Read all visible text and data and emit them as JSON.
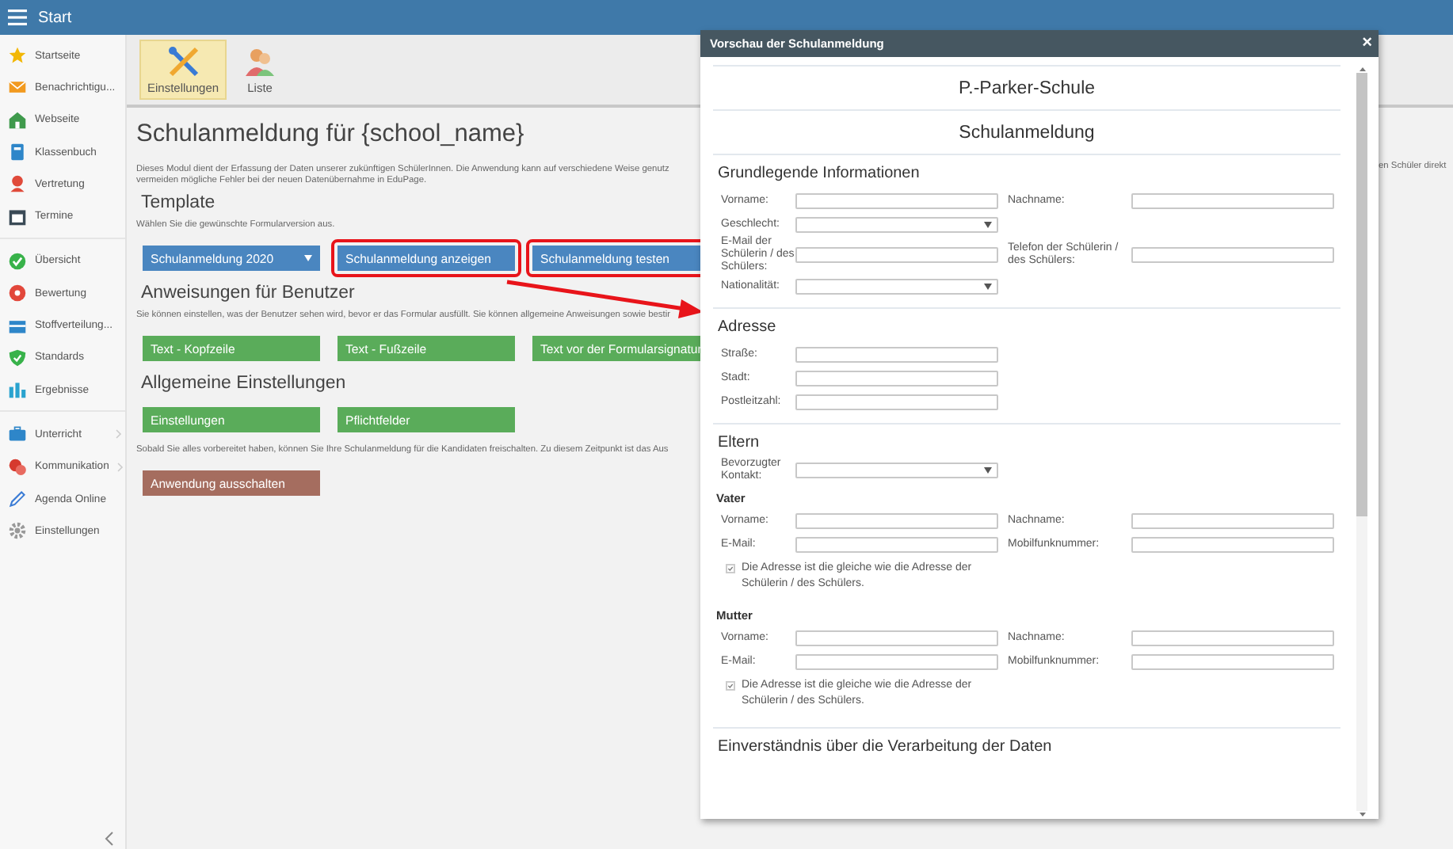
{
  "topbar": {
    "title": "Start"
  },
  "sidebar": {
    "groups": [
      {
        "items": [
          {
            "label": "Startseite",
            "submenu": false
          },
          {
            "label": "Benachrichtigu...",
            "submenu": false
          },
          {
            "label": "Webseite",
            "submenu": false
          },
          {
            "label": "Klassenbuch",
            "submenu": false
          },
          {
            "label": "Vertretung",
            "submenu": false
          },
          {
            "label": "Termine",
            "submenu": false
          }
        ]
      },
      {
        "items": [
          {
            "label": "Übersicht",
            "submenu": false
          },
          {
            "label": "Bewertung",
            "submenu": false
          },
          {
            "label": "Stoffverteilung...",
            "submenu": false
          },
          {
            "label": "Standards",
            "submenu": false
          },
          {
            "label": "Ergebnisse",
            "submenu": false
          }
        ]
      },
      {
        "items": [
          {
            "label": "Unterricht",
            "submenu": true
          },
          {
            "label": "Kommunikation",
            "submenu": true
          },
          {
            "label": "Agenda Online",
            "submenu": false
          },
          {
            "label": "Einstellungen",
            "submenu": false
          }
        ]
      }
    ]
  },
  "toolbar": [
    {
      "label": "Einstellungen",
      "selected": true
    },
    {
      "label": "Liste",
      "selected": false
    }
  ],
  "page": {
    "title": "Schulanmeldung für {school_name}",
    "intro": [
      "Dieses Modul dient der Erfassung der Daten unserer zukünftigen SchülerInnen. Die Anwendung kann auf verschiedene Weise genutz",
      "vermeiden mögliche Fehler bei der neuen Datenübernahme in EduPage."
    ],
    "intro_right": "en Schüler direkt",
    "sections": [
      {
        "heading": "Template",
        "note": "Wählen Sie die gewünschte Formularversion aus.",
        "buttons": [
          {
            "label": "Schulanmeldung 2020",
            "kind": "select",
            "highlighted": false
          },
          {
            "label": "Schulanmeldung anzeigen",
            "kind": "primary",
            "highlighted": true
          },
          {
            "label": "Schulanmeldung testen",
            "kind": "primary",
            "highlighted": true
          }
        ]
      },
      {
        "heading": "Anweisungen für Benutzer",
        "note": "Sie können einstellen, was der Benutzer sehen wird, bevor er das Formular ausfüllt. Sie können allgemeine Anweisungen sowie bestir",
        "buttons": [
          {
            "label": "Text - Kopfzeile",
            "kind": "success",
            "highlighted": false
          },
          {
            "label": "Text - Fußzeile",
            "kind": "success",
            "highlighted": false
          },
          {
            "label": "Text vor der Formularsignatur",
            "kind": "success",
            "highlighted": false
          }
        ]
      },
      {
        "heading": "Allgemeine Einstellungen",
        "buttons": [
          {
            "label": "Einstellungen",
            "kind": "success",
            "highlighted": false
          },
          {
            "label": "Pflichtfelder",
            "kind": "success",
            "highlighted": false
          }
        ]
      },
      {
        "note": "Sobald Sie alles vorbereitet haben, können Sie Ihre Schulanmeldung für die Kandidaten freischalten. Zu diesem Zeitpunkt ist das Aus",
        "buttons": [
          {
            "label": "Anwendung ausschalten",
            "kind": "danger",
            "highlighted": false
          }
        ]
      }
    ]
  },
  "dialog": {
    "title": "Vorschau der Schulanmeldung",
    "close": "×",
    "school": "P.-Parker-Schule",
    "form_title": "Schulanmeldung",
    "sections": [
      {
        "heading": "Grundlegende Informationen",
        "rows": [
          {
            "kind": "fields",
            "fields": [
              {
                "label": "Vorname:",
                "kind": "text"
              },
              {
                "label": "Nachname:",
                "kind": "text"
              }
            ]
          },
          {
            "kind": "fields",
            "fields": [
              {
                "label": "Geschlecht:",
                "kind": "select"
              }
            ]
          },
          {
            "kind": "fields",
            "fields": [
              {
                "label": "E-Mail der Schülerin / des Schülers:",
                "kind": "text"
              },
              {
                "label": "Telefon der Schülerin / des Schülers:",
                "kind": "text"
              }
            ]
          },
          {
            "kind": "fields",
            "fields": [
              {
                "label": "Nationalität:",
                "kind": "select"
              }
            ]
          }
        ]
      },
      {
        "heading": "Adresse",
        "rows": [
          {
            "kind": "fields",
            "fields": [
              {
                "label": "Straße:",
                "kind": "text"
              }
            ]
          },
          {
            "kind": "fields",
            "fields": [
              {
                "label": "Stadt:",
                "kind": "text"
              }
            ]
          },
          {
            "kind": "fields",
            "fields": [
              {
                "label": "Postleitzahl:",
                "kind": "text"
              }
            ]
          }
        ]
      },
      {
        "heading": "Eltern",
        "rows": [
          {
            "kind": "fields",
            "fields": [
              {
                "label": "Bevorzugter Kontakt:",
                "kind": "select"
              }
            ]
          },
          {
            "kind": "subheading",
            "text": "Vater"
          },
          {
            "kind": "fields",
            "fields": [
              {
                "label": "Vorname:",
                "kind": "text"
              },
              {
                "label": "Nachname:",
                "kind": "text"
              }
            ]
          },
          {
            "kind": "fields",
            "fields": [
              {
                "label": "E-Mail:",
                "kind": "text"
              },
              {
                "label": "Mobilfunknummer:",
                "kind": "text"
              }
            ]
          },
          {
            "kind": "checkbox",
            "text": "Die Adresse ist die gleiche wie die Adresse der Schülerin / des Schülers.",
            "checked": true
          },
          {
            "kind": "subheading",
            "text": "Mutter"
          },
          {
            "kind": "fields",
            "fields": [
              {
                "label": "Vorname:",
                "kind": "text"
              },
              {
                "label": "Nachname:",
                "kind": "text"
              }
            ]
          },
          {
            "kind": "fields",
            "fields": [
              {
                "label": "E-Mail:",
                "kind": "text"
              },
              {
                "label": "Mobilfunknummer:",
                "kind": "text"
              }
            ]
          },
          {
            "kind": "checkbox",
            "text": "Die Adresse ist die gleiche wie die Adresse der Schülerin / des Schülers.",
            "checked": true
          }
        ]
      },
      {
        "heading": "Einverständnis über die Verarbeitung der Daten"
      }
    ]
  }
}
